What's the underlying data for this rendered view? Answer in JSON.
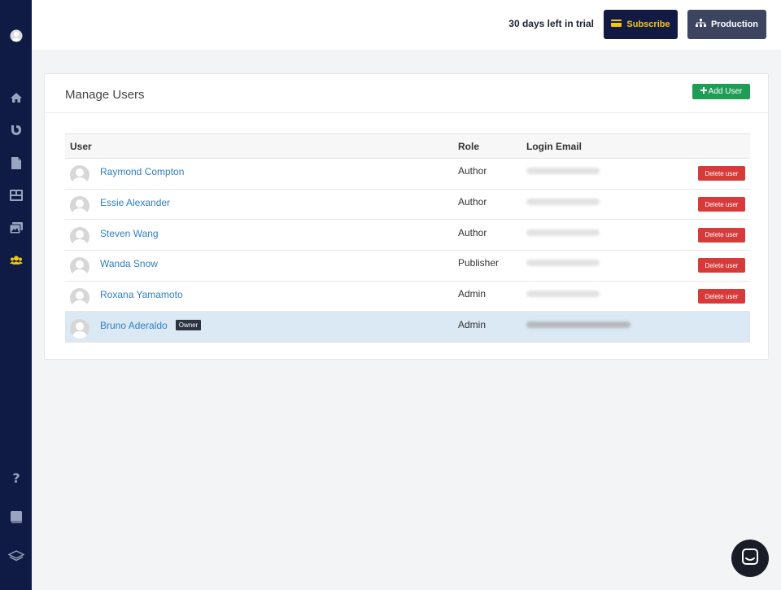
{
  "header": {
    "trial_text": "30 days left in trial",
    "subscribe_label": "Subscribe",
    "production_label": "Production"
  },
  "sidebar": {
    "items": [
      {
        "icon": "avatar-icon"
      },
      {
        "icon": "home-icon"
      },
      {
        "icon": "blog-icon"
      },
      {
        "icon": "document-icon"
      },
      {
        "icon": "layout-icon"
      },
      {
        "icon": "media-icon"
      },
      {
        "icon": "users-icon",
        "active": true
      },
      {
        "icon": "help-icon"
      },
      {
        "icon": "book-icon"
      },
      {
        "icon": "layers-icon"
      }
    ]
  },
  "main": {
    "title": "Manage Users",
    "add_user_label": "Add User",
    "columns": [
      "User",
      "Role",
      "Login Email"
    ],
    "users": [
      {
        "name": "Raymond Compton",
        "role": "Author",
        "delete_label": "Delete user"
      },
      {
        "name": "Essie Alexander",
        "role": "Author",
        "delete_label": "Delete user"
      },
      {
        "name": "Steven Wang",
        "role": "Author",
        "delete_label": "Delete user"
      },
      {
        "name": "Wanda Snow",
        "role": "Publisher",
        "delete_label": "Delete user"
      },
      {
        "name": "Roxana Yamamoto",
        "role": "Admin",
        "delete_label": "Delete user"
      },
      {
        "name": "Bruno Aderaldo",
        "role": "Admin",
        "badge": "Owner"
      }
    ]
  },
  "colors": {
    "sidebar_bg": "#0f1b44",
    "active_icon": "#f5c518",
    "subscribe_bg": "#121a44",
    "production_bg": "#3d4460",
    "add_button": "#1f9d55",
    "delete_button": "#d83a3a",
    "link": "#2f7fc2",
    "owner_row": "#dbe9f4"
  }
}
